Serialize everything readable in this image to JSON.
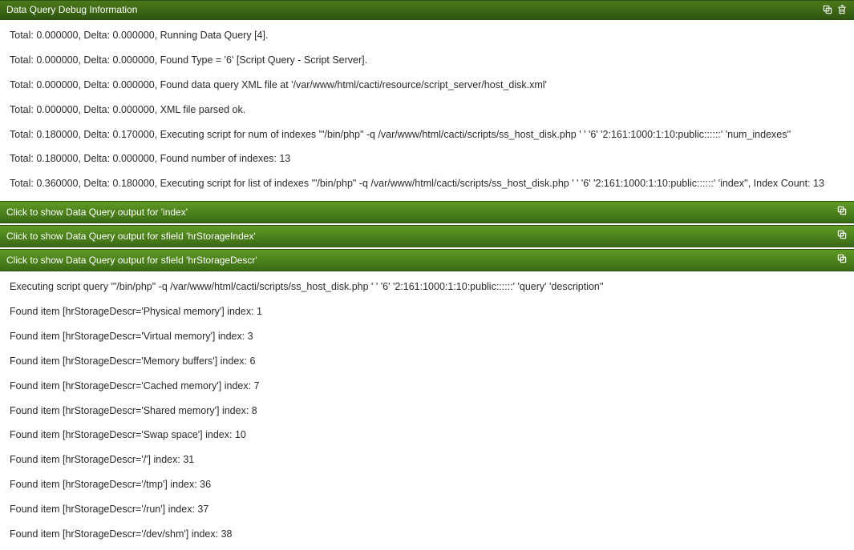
{
  "header": {
    "title": "Data Query Debug Information"
  },
  "log_lines": [
    "Total: 0.000000, Delta: 0.000000, Running Data Query [4].",
    "Total: 0.000000, Delta: 0.000000, Found Type = '6' [Script Query - Script Server].",
    "Total: 0.000000, Delta: 0.000000, Found data query XML file at '/var/www/html/cacti/resource/script_server/host_disk.xml'",
    "Total: 0.000000, Delta: 0.000000, XML file parsed ok.",
    "Total: 0.180000, Delta: 0.170000, Executing script for num of indexes '\"/bin/php\" -q /var/www/html/cacti/scripts/ss_host_disk.php '                        ' '6' '2:161:1000:1:10:public::::::' 'num_indexes''",
    "Total: 0.180000, Delta: 0.000000, Found number of indexes: 13",
    "Total: 0.360000, Delta: 0.180000, Executing script for list of indexes '\"/bin/php\" -q /var/www/html/cacti/scripts/ss_host_disk.php '                        ' '6' '2:161:1000:1:10:public::::::' 'index'', Index Count: 13"
  ],
  "sections": [
    {
      "label": "Click to show Data Query output for 'index'",
      "expanded": false
    },
    {
      "label": "Click to show Data Query output for sfield 'hrStorageIndex'",
      "expanded": false
    },
    {
      "label": "Click to show Data Query output for sfield 'hrStorageDescr'",
      "expanded": true,
      "lines": [
        "Executing script query '\"/bin/php\" -q /var/www/html/cacti/scripts/ss_host_disk.php '                        ' '6' '2:161:1000:1:10:public::::::' 'query' 'description''",
        "Found item [hrStorageDescr='Physical memory'] index: 1",
        "Found item [hrStorageDescr='Virtual memory'] index: 3",
        "Found item [hrStorageDescr='Memory buffers'] index: 6",
        "Found item [hrStorageDescr='Cached memory'] index: 7",
        "Found item [hrStorageDescr='Shared memory'] index: 8",
        "Found item [hrStorageDescr='Swap space'] index: 10",
        "Found item [hrStorageDescr='/'] index: 31",
        "Found item [hrStorageDescr='/tmp'] index: 36",
        "Found item [hrStorageDescr='/run'] index: 37",
        "Found item [hrStorageDescr='/dev/shm'] index: 38"
      ]
    }
  ],
  "icons": {
    "copy": "copy-icon",
    "trash": "trash-icon"
  }
}
